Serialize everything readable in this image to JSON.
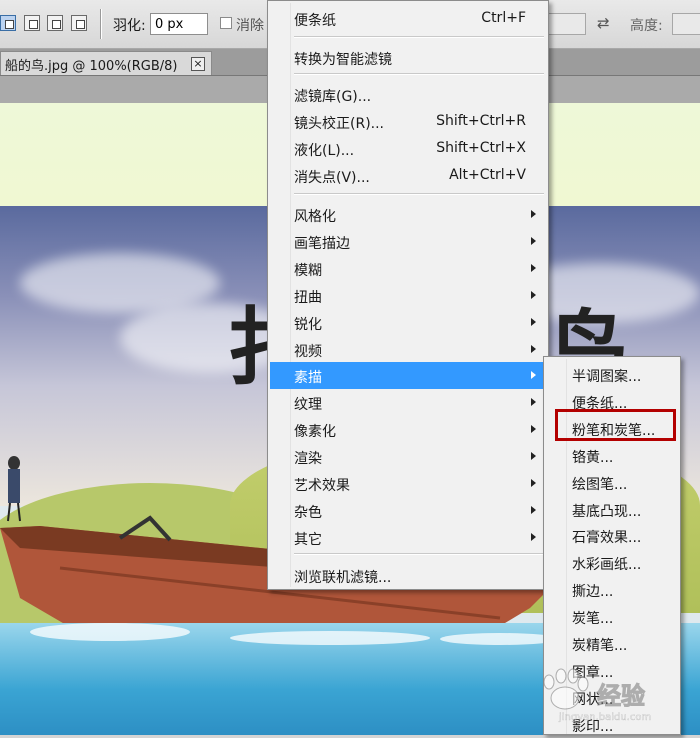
{
  "options_bar": {
    "feather_label": "羽化:",
    "feather_value": "0 px",
    "anti_alias_label": "消除",
    "height_label": "高度:"
  },
  "document": {
    "tab_title": "船的鸟.jpg @ 100%(RGB/8)",
    "close_symbol": "×"
  },
  "filter_menu": {
    "groups": [
      [
        {
          "label": "便条纸",
          "shortcut": "Ctrl+F"
        }
      ],
      [
        {
          "label": "转换为智能滤镜",
          "shortcut": ""
        }
      ],
      [
        {
          "label": "滤镜库(G)...",
          "shortcut": ""
        },
        {
          "label": "镜头校正(R)...",
          "shortcut": "Shift+Ctrl+R"
        },
        {
          "label": "液化(L)...",
          "shortcut": "Shift+Ctrl+X"
        },
        {
          "label": "消失点(V)...",
          "shortcut": "Alt+Ctrl+V"
        }
      ],
      [
        {
          "label": "风格化",
          "submenu": true
        },
        {
          "label": "画笔描边",
          "submenu": true
        },
        {
          "label": "模糊",
          "submenu": true
        },
        {
          "label": "扭曲",
          "submenu": true
        },
        {
          "label": "锐化",
          "submenu": true
        },
        {
          "label": "视频",
          "submenu": true
        },
        {
          "label": "素描",
          "submenu": true,
          "highlighted": true
        },
        {
          "label": "纹理",
          "submenu": true
        },
        {
          "label": "像素化",
          "submenu": true
        },
        {
          "label": "渲染",
          "submenu": true
        },
        {
          "label": "艺术效果",
          "submenu": true
        },
        {
          "label": "杂色",
          "submenu": true
        },
        {
          "label": "其它",
          "submenu": true
        }
      ],
      [
        {
          "label": "浏览联机滤镜...",
          "shortcut": ""
        }
      ]
    ]
  },
  "sketch_submenu": {
    "items": [
      "半调图案...",
      "便条纸...",
      "粉笔和炭笔...",
      "铬黄...",
      "绘图笔...",
      "基底凸现...",
      "石膏效果...",
      "水彩画纸...",
      "撕边...",
      "炭笔...",
      "炭精笔...",
      "图章...",
      "网状...",
      "影印..."
    ],
    "boxed_item": "粉笔和炭笔..."
  },
  "canvas": {
    "painted_chars": [
      "扌",
      "鸟"
    ]
  },
  "watermark": {
    "text": "经验",
    "url": "jingyan.baidu.com"
  },
  "colors": {
    "menu_highlight": "#3399ff",
    "annotation_box": "#b30000"
  }
}
